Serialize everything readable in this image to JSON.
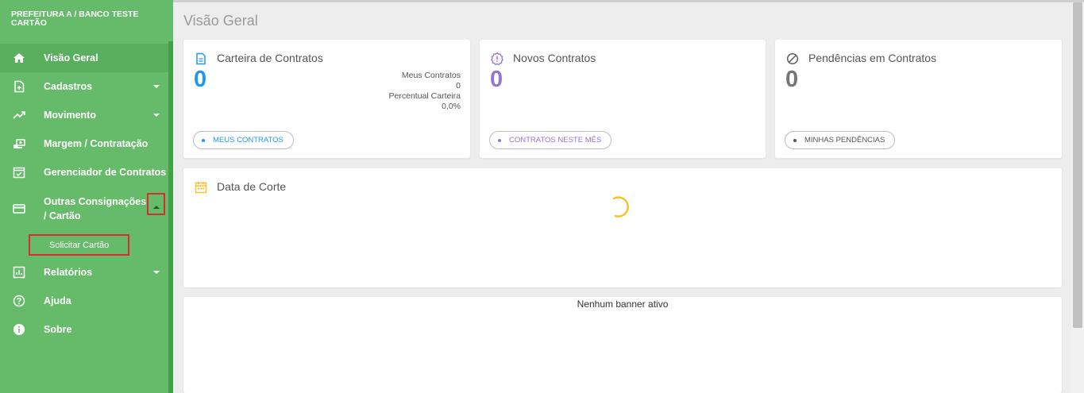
{
  "sidebar": {
    "org_name": "PREFEITURA A / BANCO TESTE CARTÃO",
    "items": [
      {
        "label": "Visão Geral",
        "icon": "home-icon"
      },
      {
        "label": "Cadastros",
        "icon": "add-document-icon"
      },
      {
        "label": "Movimento",
        "icon": "trending-up-icon"
      },
      {
        "label": "Margem / Contratação",
        "icon": "hand-money-icon"
      },
      {
        "label": "Gerenciador de Contratos",
        "icon": "checked-calendar-icon"
      },
      {
        "label": "Outras Consignações / Cartão",
        "icon": "credit-card-icon"
      },
      {
        "label": "Relatórios",
        "icon": "bar-chart-icon"
      },
      {
        "label": "Ajuda",
        "icon": "help-icon"
      },
      {
        "label": "Sobre",
        "icon": "info-icon"
      }
    ],
    "subitem": "Solicitar Cartão"
  },
  "main": {
    "title": "Visão Geral",
    "cards": {
      "carteira": {
        "title": "Carteira de Contratos",
        "value": "0",
        "meus_label": "Meus Contratos",
        "meus_value": "0",
        "percentual_label": "Percentual Carteira",
        "percentual_value": "0,0%",
        "button": "MEUS CONTRATOS",
        "color": "#2196f3"
      },
      "novos": {
        "title": "Novos Contratos",
        "value": "0",
        "button": "CONTRATOS NESTE MÊS",
        "color": "#9575cd"
      },
      "pendencias": {
        "title": "Pendências em Contratos",
        "value": "0",
        "button": "MINHAS PENDÊNCIAS",
        "color": "#757575"
      }
    },
    "data_corte": {
      "title": "Data de Corte"
    },
    "banner": {
      "text": "Nenhum banner ativo"
    }
  },
  "colors": {
    "sidebar": "#66bb6a",
    "highlight": "#d32f2f",
    "spinner": "#fbc02d"
  }
}
